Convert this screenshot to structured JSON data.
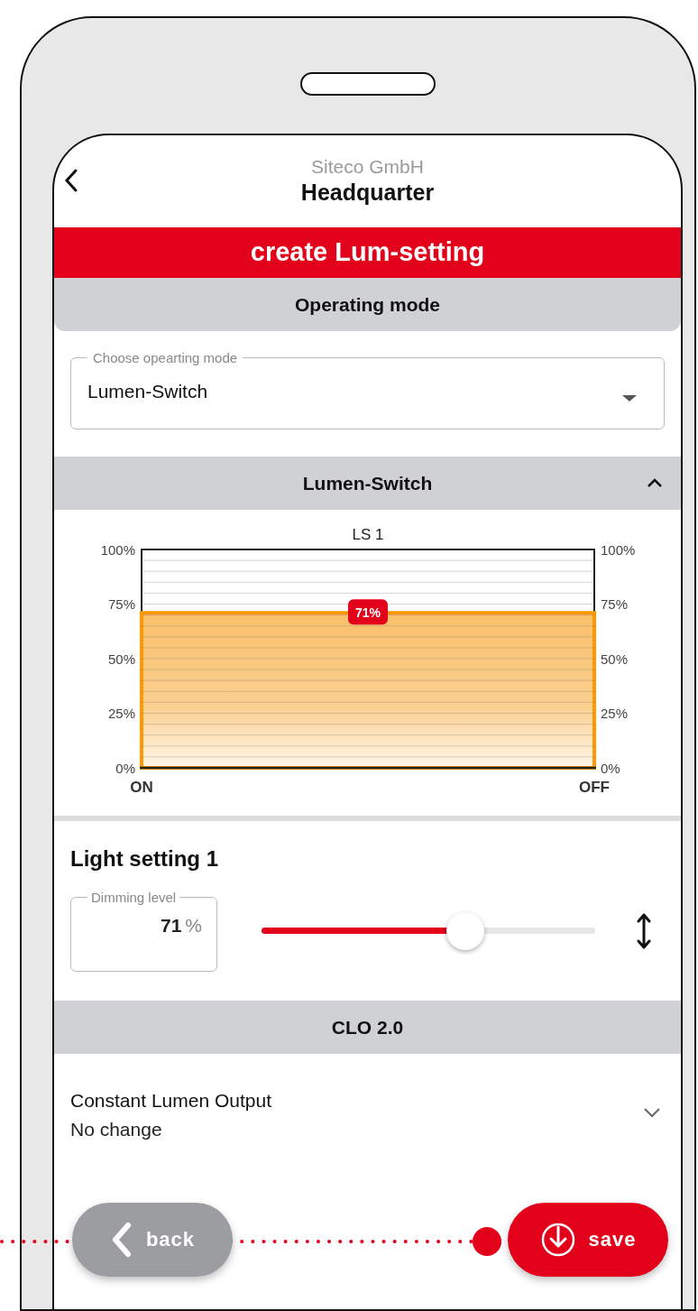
{
  "header": {
    "subtitle": "Siteco GmbH",
    "title": "Headquarter"
  },
  "banner": "create Lum-setting",
  "operating_mode": {
    "heading": "Operating mode",
    "select": {
      "label": "Choose opearting mode",
      "value": "Lumen-Switch"
    }
  },
  "lumen_switch": {
    "heading": "Lumen-Switch",
    "expanded": true,
    "chart_data": {
      "type": "area",
      "title": "LS 1",
      "categories": [
        "ON",
        "OFF"
      ],
      "values": [
        71,
        71
      ],
      "ylim": [
        0,
        100
      ],
      "yticks": [
        {
          "value": 0,
          "label": "0%"
        },
        {
          "value": 25,
          "label": "25%"
        },
        {
          "value": 50,
          "label": "50%"
        },
        {
          "value": 75,
          "label": "75%"
        },
        {
          "value": 100,
          "label": "100%"
        }
      ],
      "annotations": [
        {
          "y": 71,
          "text": "71%"
        }
      ]
    }
  },
  "light_setting": {
    "title": "Light setting 1",
    "dimming": {
      "label": "Dimming level",
      "value": "71",
      "unit": "%"
    },
    "slider": {
      "level": 0.61
    }
  },
  "clo": {
    "heading": "CLO 2.0",
    "item": {
      "title": "Constant Lumen Output",
      "value": "No change",
      "expanded": false
    }
  },
  "buttons": [
    {
      "kind": "back",
      "label": "back"
    },
    {
      "kind": "save",
      "label": "save"
    }
  ]
}
